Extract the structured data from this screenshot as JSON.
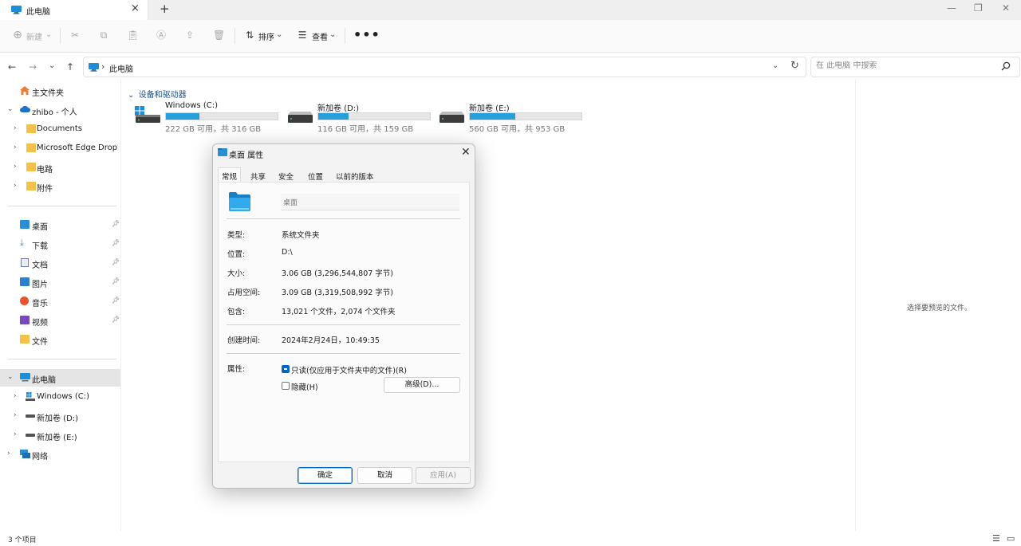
{
  "tab": {
    "title": "此电脑",
    "close_icon": "×",
    "new_tab_icon": "+"
  },
  "window": {
    "minimize": "—",
    "restore": "❐",
    "close": "✕"
  },
  "toolbar": {
    "new_label": "新建",
    "sort_label": "排序",
    "view_label": "查看",
    "more_label": "•••"
  },
  "address": {
    "crumb": "此电脑",
    "separator": "›"
  },
  "search": {
    "placeholder": "在 此电脑 中搜索"
  },
  "sidebar": {
    "home": "主文件夹",
    "onedrive": "zhibo - 个人",
    "onedrive_items": [
      "Documents",
      "Microsoft Edge Drop Files",
      "电路",
      "附件"
    ],
    "quick": [
      {
        "label": "桌面",
        "icon": "desktop-icon",
        "color": "#2b8fd6"
      },
      {
        "label": "下载",
        "icon": "download-icon",
        "color": "#1e9be6"
      },
      {
        "label": "文档",
        "icon": "document-icon",
        "color": "#6a7fa8"
      },
      {
        "label": "图片",
        "icon": "pictures-icon",
        "color": "#2f7fcb"
      },
      {
        "label": "音乐",
        "icon": "music-icon",
        "color": "#e8552d"
      },
      {
        "label": "视频",
        "icon": "video-icon",
        "color": "#7a49b8"
      },
      {
        "label": "文件",
        "icon": "folder-icon",
        "color": "#f3c04a"
      }
    ],
    "this_pc": "此电脑",
    "drives": [
      "Windows (C:)",
      "新加卷 (D:)",
      "新加卷 (E:)"
    ],
    "network": "网络"
  },
  "content": {
    "group_title": "设备和驱动器",
    "drives": [
      {
        "name": "Windows (C:)",
        "info": "222 GB 可用，共 316 GB",
        "used_fraction": 0.297
      },
      {
        "name": "新加卷 (D:)",
        "info": "116 GB 可用，共 159 GB",
        "used_fraction": 0.27
      },
      {
        "name": "新加卷 (E:)",
        "info": "560 GB 可用，共 953 GB",
        "used_fraction": 0.41
      }
    ],
    "preview_hint": "选择要预览的文件。"
  },
  "status": {
    "item_count": "3 个项目"
  },
  "dialog": {
    "title": "桌面 属性",
    "tabs": [
      "常规",
      "共享",
      "安全",
      "位置",
      "以前的版本"
    ],
    "name_value": "桌面",
    "rows": [
      {
        "key": "类型:",
        "value": "系统文件夹"
      },
      {
        "key": "位置:",
        "value": "D:\\"
      },
      {
        "key": "大小:",
        "value": "3.06 GB (3,296,544,807 字节)"
      },
      {
        "key": "占用空间:",
        "value": "3.09 GB (3,319,508,992 字节)"
      },
      {
        "key": "包含:",
        "value": "13,021 个文件，2,074 个文件夹"
      }
    ],
    "created_key": "创建时间:",
    "created_value": "2024年2月24日，10:49:35",
    "attr_key": "属性:",
    "readonly_label": "只读(仅应用于文件夹中的文件)(R)",
    "hidden_label": "隐藏(H)",
    "advanced_label": "高级(D)...",
    "ok_label": "确定",
    "cancel_label": "取消",
    "apply_label": "应用(A)"
  },
  "colors": {
    "accent": "#0067c0",
    "drive_fill": "#26a0da",
    "link_blue": "#1f4f8f"
  }
}
